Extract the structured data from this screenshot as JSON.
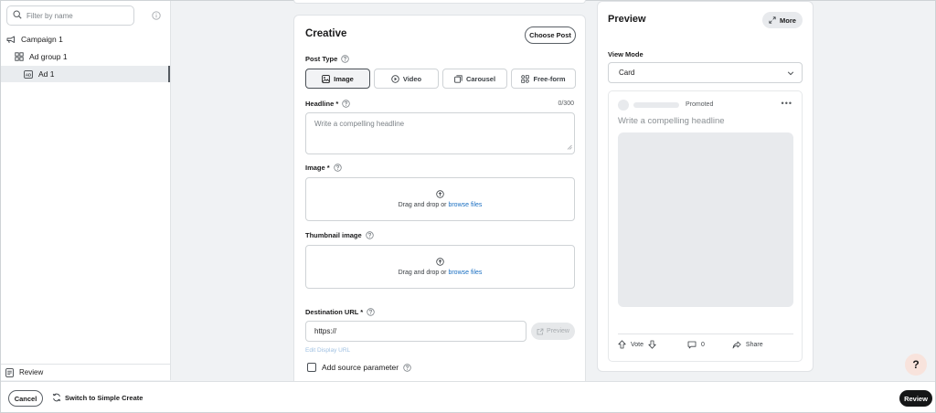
{
  "sidebar": {
    "filter_placeholder": "Filter by name",
    "tree": [
      {
        "label": "Campaign 1",
        "icon": "megaphone-icon"
      },
      {
        "label": "Ad group 1",
        "icon": "grid-icon"
      },
      {
        "label": "Ad 1",
        "icon": "ad-icon",
        "selected": true
      }
    ],
    "review_label": "Review"
  },
  "creative": {
    "title": "Creative",
    "choose_post_label": "Choose Post",
    "post_type_label": "Post Type",
    "post_types": [
      {
        "label": "Image",
        "icon": "image-icon",
        "active": true
      },
      {
        "label": "Video",
        "icon": "play-icon"
      },
      {
        "label": "Carousel",
        "icon": "carousel-icon"
      },
      {
        "label": "Free-form",
        "icon": "freeform-icon"
      }
    ],
    "headline_label": "Headline *",
    "headline_counter": "0/300",
    "headline_placeholder": "Write a compelling headline",
    "image_label": "Image *",
    "image_drop_text": "Drag and drop or ",
    "image_drop_link": "browse files",
    "thumbnail_label": "Thumbnail image",
    "thumbnail_drop_text": "Drag and drop or ",
    "thumbnail_drop_link": "browse files",
    "destination_label": "Destination URL *",
    "destination_value": "https://",
    "preview_button_label": "Preview",
    "edit_display_url": "Edit Display URL",
    "source_param_label": "Add source parameter"
  },
  "preview": {
    "title": "Preview",
    "more_label": "More",
    "view_mode_label": "View Mode",
    "view_mode_value": "Card",
    "card": {
      "promoted": "Promoted",
      "menu_dots": "•••",
      "headline": "Write a compelling headline",
      "vote_label": "Vote",
      "comment_count": "0",
      "share_label": "Share"
    }
  },
  "help_label": "?",
  "footer": {
    "cancel_label": "Cancel",
    "switch_label": "Switch to Simple Create",
    "review_label": "Review"
  }
}
